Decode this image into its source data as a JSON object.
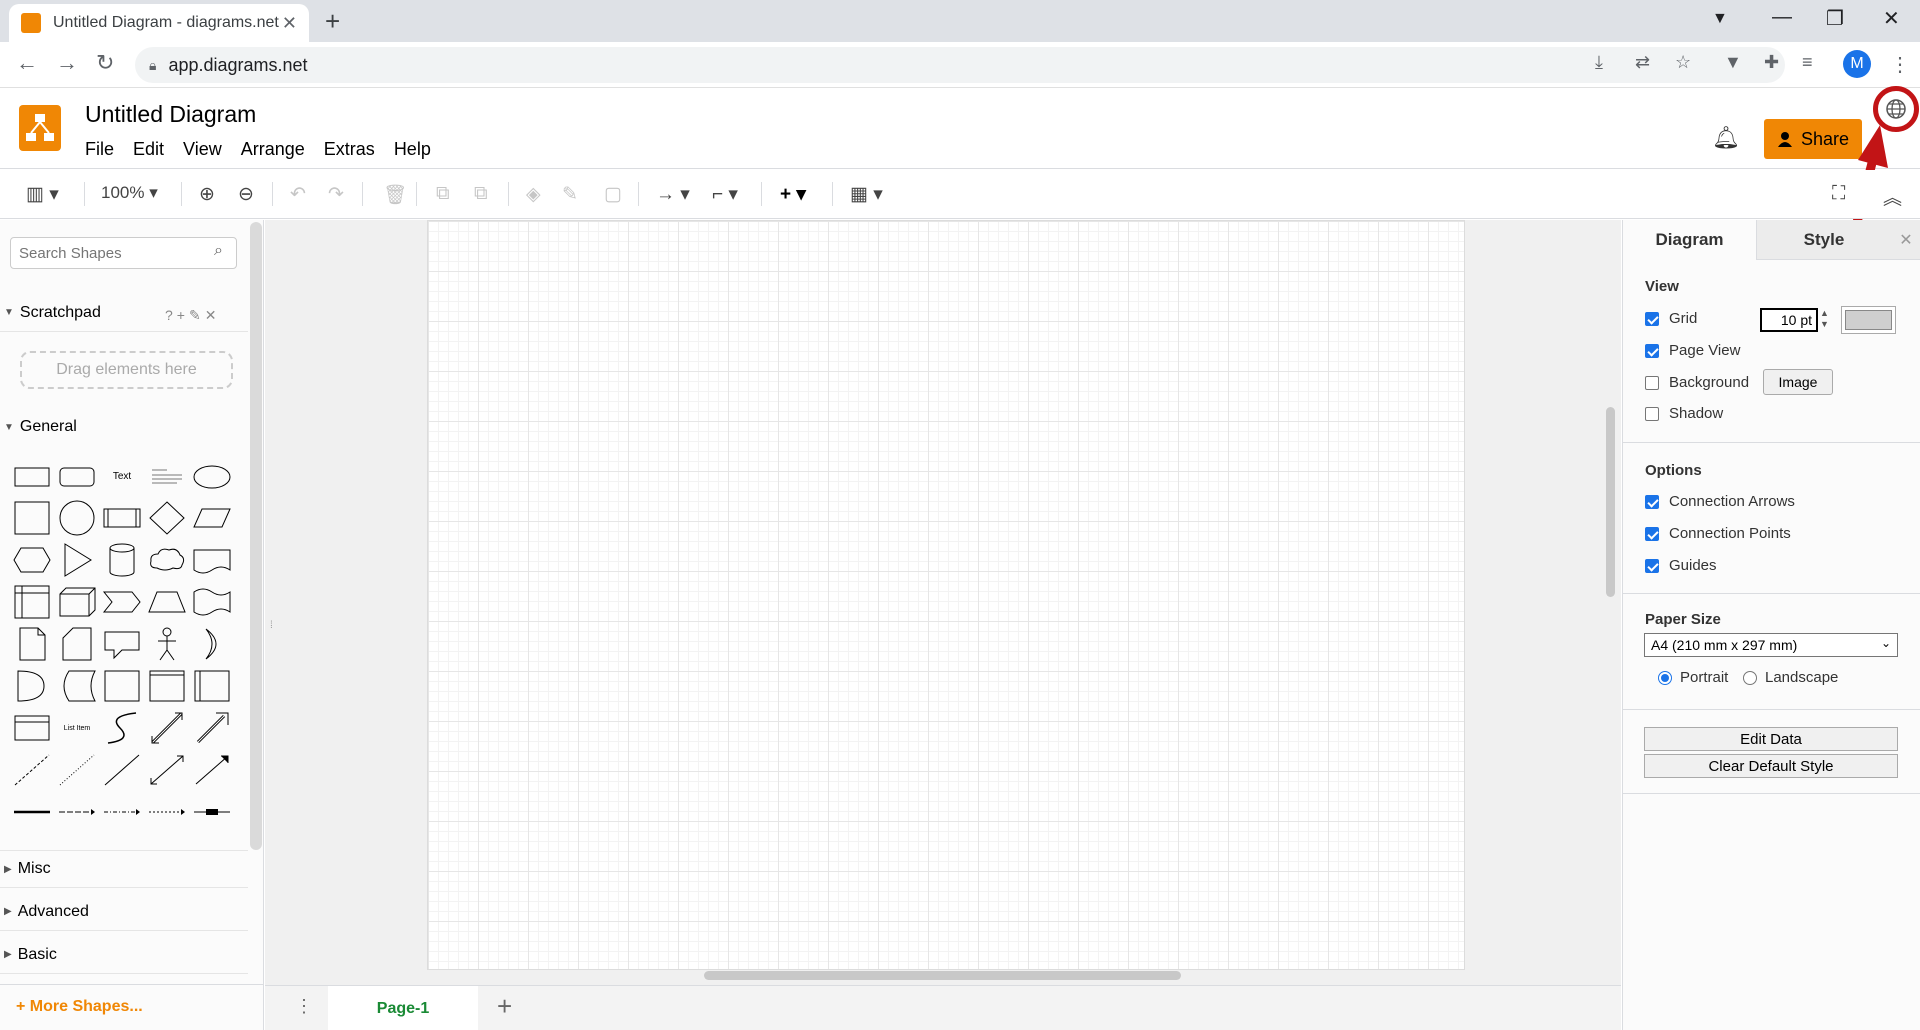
{
  "browser": {
    "tab_title": "Untitled Diagram - diagrams.net",
    "url": "app.diagrams.net",
    "profile_initial": "M"
  },
  "app": {
    "doc_title": "Untitled Diagram",
    "menu": [
      "File",
      "Edit",
      "View",
      "Arrange",
      "Extras",
      "Help"
    ],
    "share_label": "Share",
    "brand_color": "#f08705"
  },
  "toolbar": {
    "zoom": "100%"
  },
  "sidebar": {
    "search_placeholder": "Search Shapes",
    "scratchpad_label": "Scratchpad",
    "drag_hint": "Drag elements here",
    "general_label": "General",
    "shape_text_label": "Text",
    "shape_list_item_label": "List Item",
    "sections": [
      "Misc",
      "Advanced",
      "Basic"
    ],
    "more_shapes": "+ More Shapes..."
  },
  "pages": {
    "current": "Page-1"
  },
  "format_panel": {
    "tabs": [
      "Diagram",
      "Style"
    ],
    "view_heading": "View",
    "grid_label": "Grid",
    "grid_size": "10 pt",
    "page_view_label": "Page View",
    "background_label": "Background",
    "image_button": "Image",
    "shadow_label": "Shadow",
    "options_heading": "Options",
    "connection_arrows_label": "Connection Arrows",
    "connection_points_label": "Connection Points",
    "guides_label": "Guides",
    "paper_size_heading": "Paper Size",
    "paper_size_value": "A4 (210 mm x 297 mm)",
    "portrait_label": "Portrait",
    "landscape_label": "Landscape",
    "edit_data_button": "Edit Data",
    "clear_style_button": "Clear Default Style",
    "checked": {
      "grid": true,
      "page_view": true,
      "background": false,
      "shadow": false,
      "connection_arrows": true,
      "connection_points": true,
      "guides": true
    },
    "orientation": "portrait"
  },
  "annotation": {
    "highlight_color": "#c21416"
  }
}
